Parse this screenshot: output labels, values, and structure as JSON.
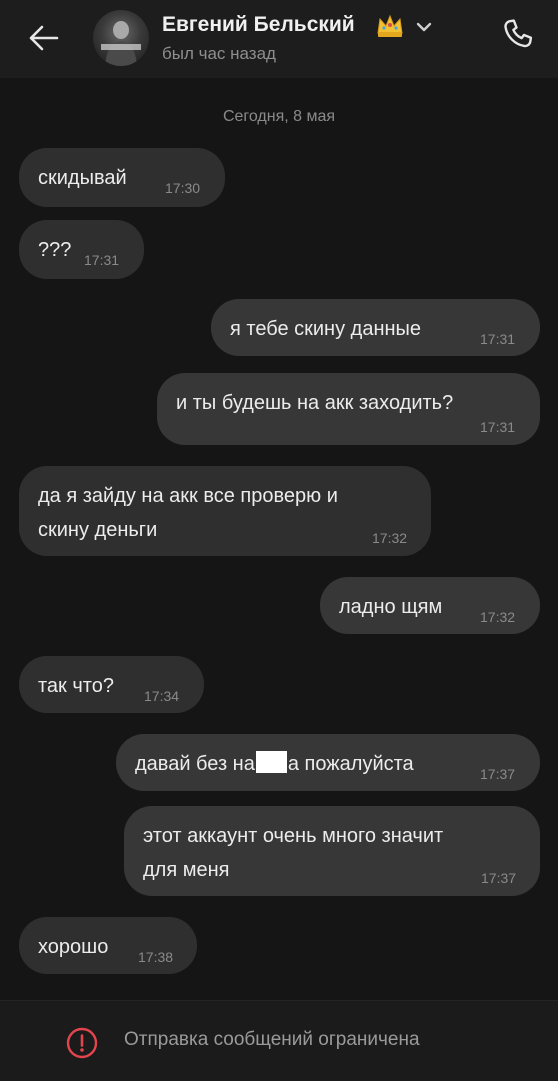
{
  "header": {
    "back_icon": "arrow-left-icon",
    "contact_name": "Евгений Бельский",
    "crown_icon": "crown-emoji",
    "chevron_icon": "chevron-down-icon",
    "status": "был час назад",
    "call_icon": "phone-icon"
  },
  "chat": {
    "date_divider": "Сегодня, 8 мая",
    "messages": [
      {
        "direction": "in",
        "text": "скидывай",
        "time": "17:30"
      },
      {
        "direction": "in",
        "text": "???",
        "time": "17:31"
      },
      {
        "direction": "out",
        "text": "я тебе скину данные",
        "time": "17:31"
      },
      {
        "direction": "out",
        "text": "и ты будешь на акк заходить?",
        "time": "17:31"
      },
      {
        "direction": "in",
        "text_line1": "да я зайду на акк все проверю и",
        "text_line2": "скину деньги",
        "time": "17:32"
      },
      {
        "direction": "out",
        "text": "ладно щям",
        "time": "17:32"
      },
      {
        "direction": "in",
        "text": "так что?",
        "time": "17:34"
      },
      {
        "direction": "out",
        "text_before": "давай без на",
        "text_after": "а пожалуйста",
        "time": "17:37"
      },
      {
        "direction": "out",
        "text_line1": "этот аккаунт очень много значит",
        "text_line2": "для меня",
        "time": "17:37"
      },
      {
        "direction": "in",
        "text": "хорошо",
        "time": "17:38"
      }
    ]
  },
  "footer": {
    "icon": "alert-circle-icon",
    "text": "Отправка сообщений ограничена"
  },
  "colors": {
    "background": "#151515",
    "header": "#1d1d1d",
    "bubble_in": "#2f2f2f",
    "bubble_out": "#373737",
    "alert": "#e2454d"
  }
}
